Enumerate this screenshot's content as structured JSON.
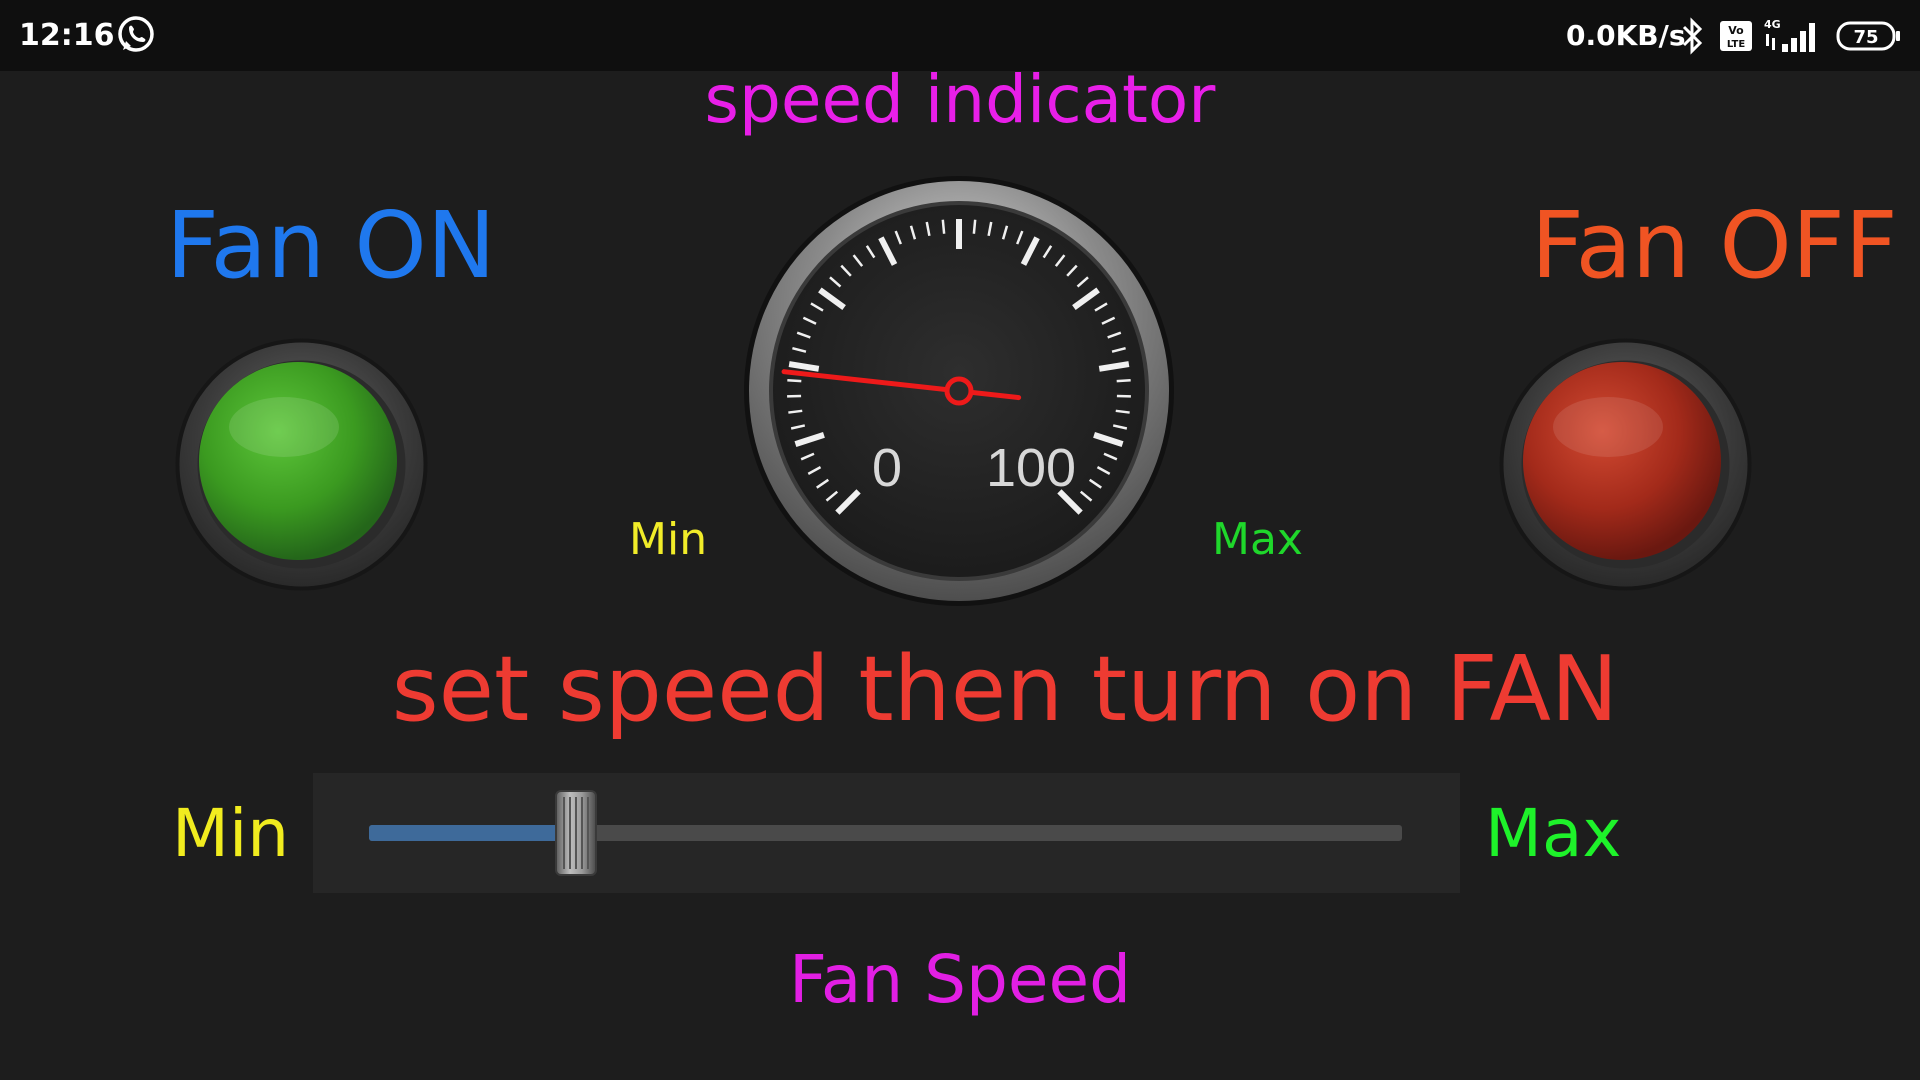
{
  "status_bar": {
    "time": "12:16",
    "net_speed": "0.0KB/s",
    "battery": "75",
    "network": "4G",
    "icons": [
      "whatsapp-icon",
      "bluetooth-icon",
      "volte-icon",
      "signal-icon",
      "battery-icon"
    ]
  },
  "gauge": {
    "title": "speed indicator",
    "min_label": "Min",
    "max_label": "Max",
    "dial_left_number": "0",
    "dial_right_number": "100",
    "needle_fraction": 0.19
  },
  "fan_on": {
    "label": "Fan ON",
    "color": "#1f78ee",
    "button_color": "#3a9a22"
  },
  "fan_off": {
    "label": "Fan OFF",
    "color": "#f05423",
    "button_color": "#a82a1a"
  },
  "instruction": "set speed then turn on FAN",
  "slider": {
    "min_label": "Min",
    "max_label": "Max",
    "value_fraction": 0.2,
    "caption": "Fan Speed",
    "fill_color": "#3e6a9a"
  },
  "colors": {
    "background": "#1d1d1d",
    "title_magenta": "#e81fe8",
    "instruction_red": "#ee3b32",
    "min_yellow": "#f1ec29",
    "max_green": "#1fd72b"
  }
}
